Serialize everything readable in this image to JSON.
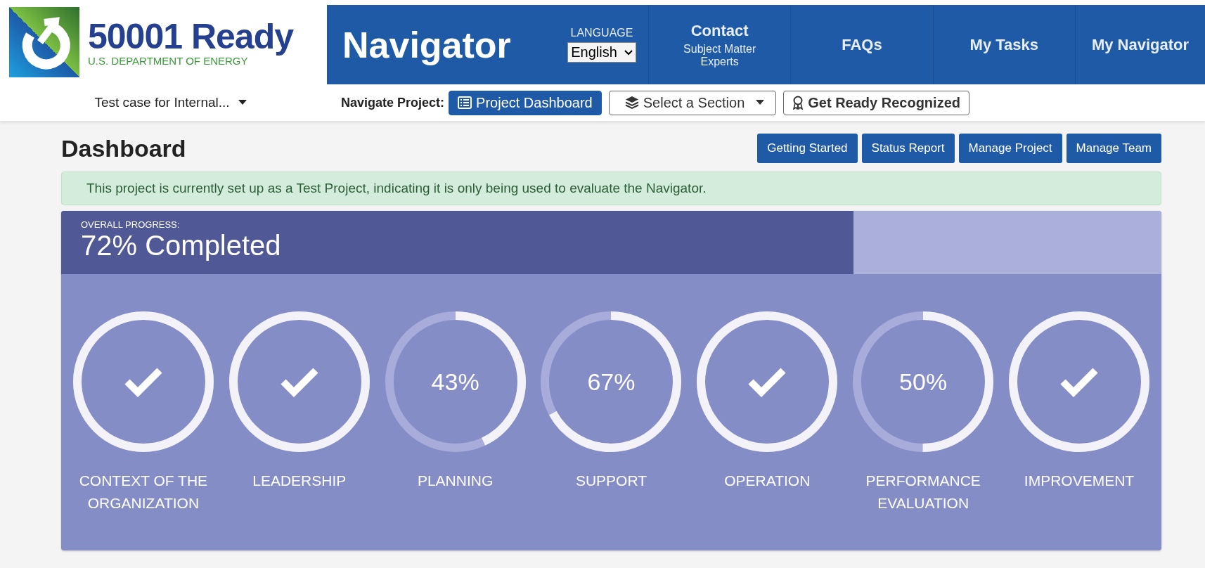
{
  "logo": {
    "title": "50001 Ready",
    "subtitle": "U.S. DEPARTMENT OF ENERGY"
  },
  "header": {
    "title": "Navigator",
    "language": {
      "label": "LANGUAGE",
      "value": "English"
    },
    "nav": [
      {
        "label": "Contact",
        "sublabel": "Subject Matter Experts"
      },
      {
        "label": "FAQs"
      },
      {
        "label": "My Tasks"
      },
      {
        "label": "My Navigator"
      }
    ]
  },
  "subnav": {
    "project": "Test case for Internal...",
    "navigate_label": "Navigate Project:",
    "buttons": [
      {
        "label": "Project Dashboard",
        "kind": "primary"
      },
      {
        "label": "Select a Section",
        "kind": "dropdown"
      },
      {
        "label": "Get Ready Recognized",
        "kind": "award"
      }
    ]
  },
  "dashboard": {
    "title": "Dashboard",
    "actions": [
      "Getting Started",
      "Status Report",
      "Manage Project",
      "Manage Team"
    ],
    "alert": "This project is currently set up as a Test Project, indicating it is only being used to evaluate the Navigator.",
    "progress": {
      "label": "OVERALL PROGRESS:",
      "text": "72% Completed",
      "level": 0.72
    },
    "sections": [
      {
        "name": "CONTEXT OF THE ORGANIZATION",
        "kind": "complete",
        "level": 1
      },
      {
        "name": "LEADERSHIP",
        "kind": "complete",
        "level": 1
      },
      {
        "name": "PLANNING",
        "kind": "percent",
        "level": 0.43,
        "reading": "43%"
      },
      {
        "name": "SUPPORT",
        "kind": "percent",
        "level": 0.67,
        "reading": "67%"
      },
      {
        "name": "OPERATION",
        "kind": "complete",
        "level": 1
      },
      {
        "name": "PERFORMANCE EVALUATION",
        "kind": "percent",
        "level": 0.5,
        "reading": "50%"
      },
      {
        "name": "IMPROVEMENT",
        "kind": "complete",
        "level": 1
      }
    ]
  }
}
